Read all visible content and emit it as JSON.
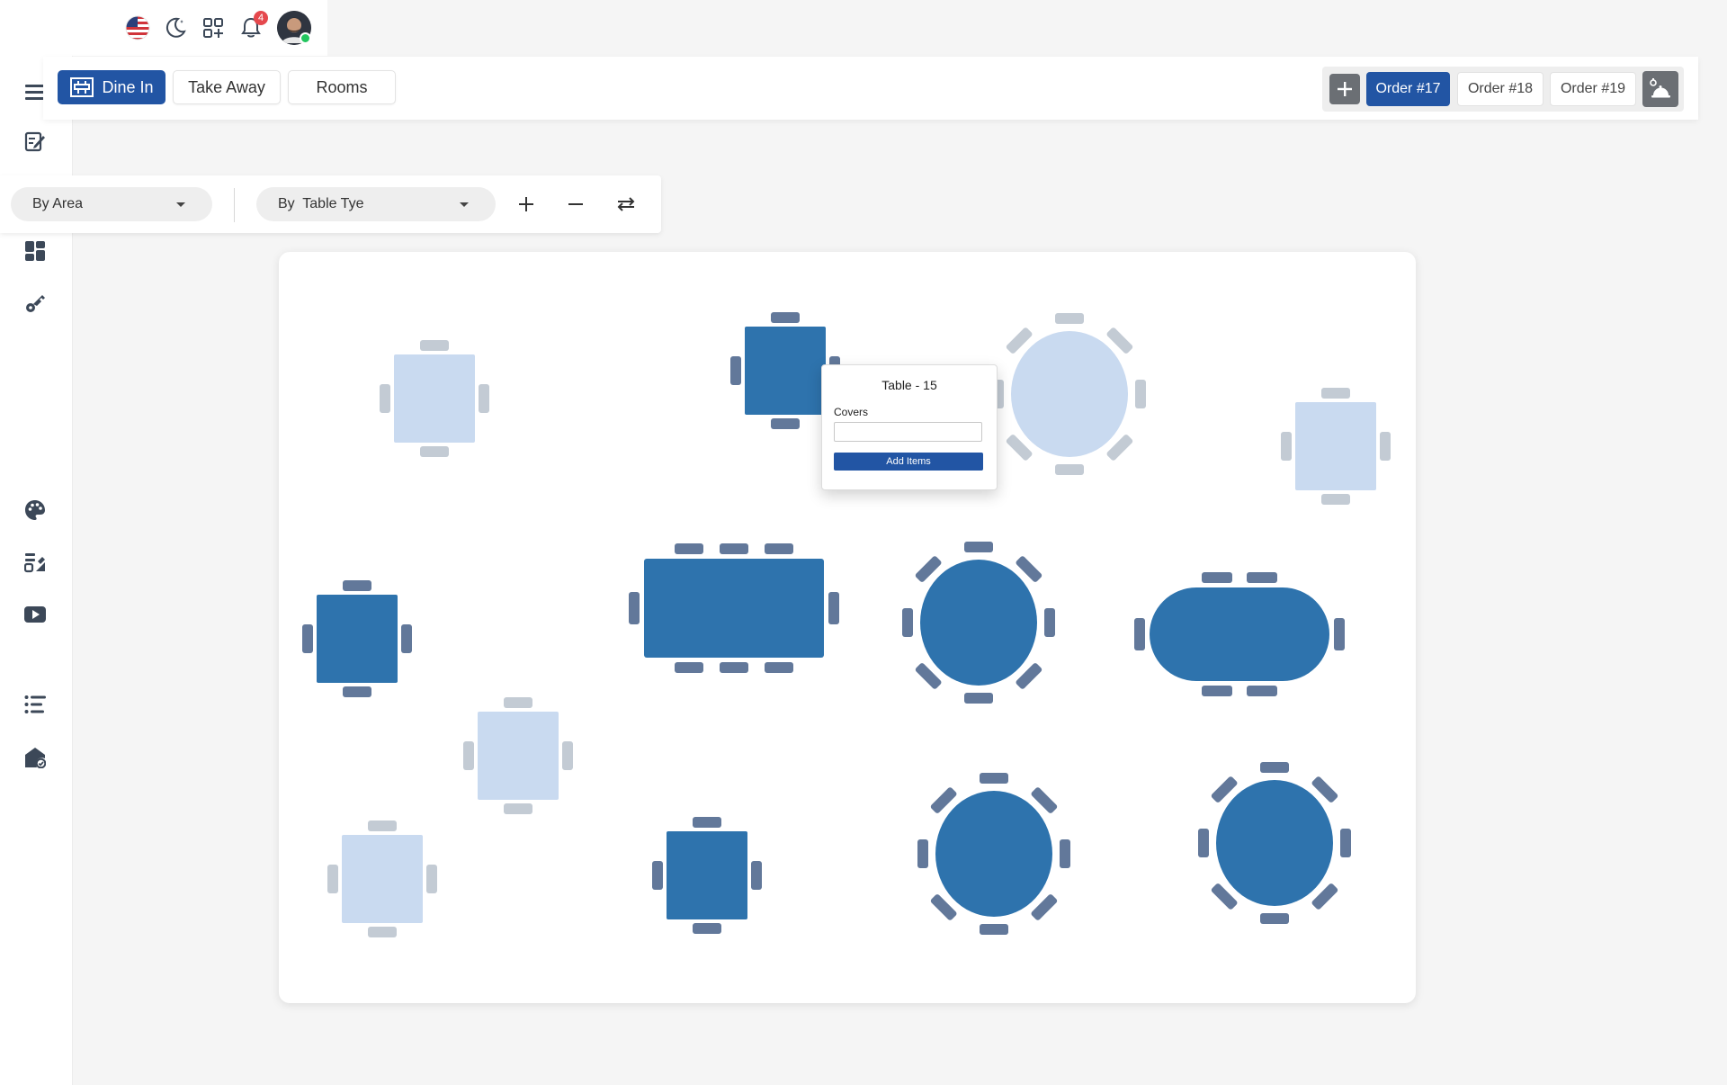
{
  "top_bar": {
    "icons": [
      "us-flag-icon",
      "moon-icon",
      "apps-grid-icon",
      "bell-icon",
      "avatar"
    ],
    "notification_count": "4"
  },
  "sidebar": {
    "icons": [
      "menu-icon",
      "edit-note-icon",
      "dashboard-icon",
      "key-icon",
      "palette-icon",
      "category-icon",
      "video-icon",
      "list-icon",
      "house-check-icon"
    ]
  },
  "service_tabs": {
    "dine_in": "Dine In",
    "take_away": "Take Away",
    "rooms": "Rooms"
  },
  "orders": {
    "items": [
      "Order #17",
      "Order #18",
      "Order #19"
    ],
    "active": "Order #17"
  },
  "filters": {
    "by_area": "By Area",
    "by_table_type": "By  Table Tye"
  },
  "popup": {
    "title": "Table - 15",
    "covers_label": "Covers",
    "covers_value": "",
    "add_button": "Add Items"
  },
  "colors": {
    "accent": "#2255a4",
    "table_occupied": "#2e73ad",
    "table_free": "#c9daf0",
    "chair_occupied": "#62789a",
    "chair_free": "#c3cbd4"
  }
}
